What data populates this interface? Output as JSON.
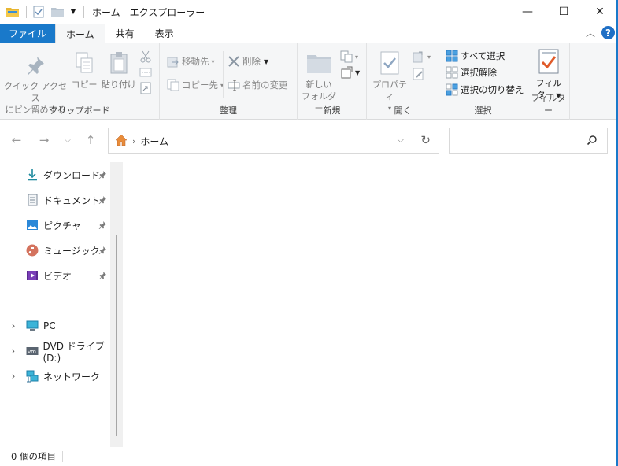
{
  "window": {
    "title": "ホーム - エクスプローラー",
    "controls": {
      "minimize": "—",
      "maximize": "☐",
      "close": "✕"
    }
  },
  "ribbon_tabs": [
    {
      "label": "ファイル",
      "state": "file"
    },
    {
      "label": "ホーム",
      "state": "active"
    },
    {
      "label": "共有",
      "state": "normal"
    },
    {
      "label": "表示",
      "state": "normal"
    }
  ],
  "ribbon": {
    "clipboard": {
      "label": "クリップボード",
      "pin_quick_access": [
        "クイック アクセス",
        "にピン留めする"
      ],
      "copy": "コピー",
      "paste": "貼り付け"
    },
    "organize": {
      "label": "整理",
      "move_to": "移動先",
      "copy_to": "コピー先",
      "delete": "削除",
      "rename": "名前の変更"
    },
    "new": {
      "label": "新規",
      "new_folder": [
        "新しい",
        "フォルダー"
      ]
    },
    "open": {
      "label": "開く",
      "properties": "プロパティ"
    },
    "select": {
      "label": "選択",
      "select_all": "すべて選択",
      "select_none": "選択解除",
      "invert": "選択の切り替え"
    },
    "filter": {
      "label": "フィルター",
      "button": [
        "フィル",
        "ター"
      ]
    }
  },
  "address": {
    "location": "ホーム",
    "separator": "›"
  },
  "search": {
    "placeholder": ""
  },
  "nav": {
    "quick_access": [
      {
        "label": "ダウンロード",
        "icon": "download-icon"
      },
      {
        "label": "ドキュメント",
        "icon": "documents-icon"
      },
      {
        "label": "ピクチャ",
        "icon": "pictures-icon"
      },
      {
        "label": "ミュージック",
        "icon": "music-icon"
      },
      {
        "label": "ビデオ",
        "icon": "video-icon"
      }
    ],
    "locations": [
      {
        "label": "PC",
        "icon": "pc-icon"
      },
      {
        "label": "DVD ドライブ (D:)",
        "icon": "dvd-drive-icon"
      },
      {
        "label": "ネットワーク",
        "icon": "network-icon"
      }
    ]
  },
  "status": {
    "item_count": "0 個の項目"
  },
  "colors": {
    "accent": "#1979ca",
    "ribbon_bg": "#f5f6f7",
    "help": "#1f6fc5"
  }
}
